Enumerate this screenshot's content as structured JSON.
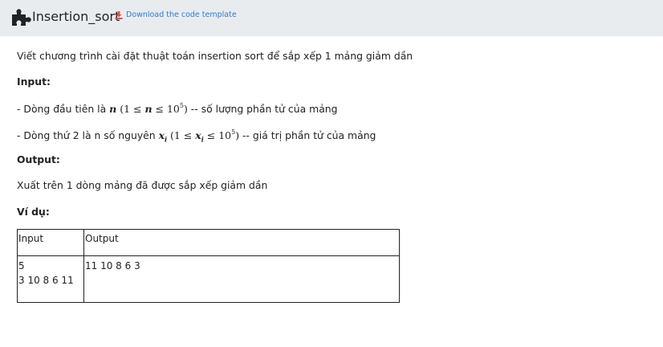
{
  "header": {
    "title": "Insertion_sort",
    "download_label": "Download the code template",
    "puzzle_icon": "puzzle-icon",
    "download_icon": "download-icon",
    "download_color": "#2f7bd4",
    "download_icon_color": "#d9534f",
    "background": "#e9ecef"
  },
  "problem": {
    "description": "Viết chương trình cài đặt thuật toán insertion sort để sắp xếp 1 mảng giảm dần",
    "input_heading": "Input:",
    "input_line1_prefix": "- Dòng đầu tiên là ",
    "input_line1_var": "n",
    "input_line1_cond_open": "(1 ≤ ",
    "input_line1_cond_var": "n",
    "input_line1_cond_close": " ≤ 10",
    "input_line1_exp": "5",
    "input_line1_paren": ")",
    "input_line1_suffix": " -- số lượng phần tử của mảng",
    "input_line2_prefix": "- Dòng thứ 2 là n số nguyên ",
    "input_line2_var": "x",
    "input_line2_sub": "i",
    "input_line2_cond_open": "(1 ≤ ",
    "input_line2_cond_var": "x",
    "input_line2_cond_sub": "i",
    "input_line2_cond_close": " ≤ 10",
    "input_line2_exp": "5",
    "input_line2_paren": ")",
    "input_line2_suffix": " -- giá trị phần tử của mảng",
    "output_heading": "Output:",
    "output_text": "Xuất trên 1 dòng mảng đã được sắp xếp giảm dần",
    "example_heading": "Ví dụ:"
  },
  "example_table": {
    "headers": [
      "Input",
      "Output"
    ],
    "input_lines": [
      "5",
      "3 10 8 6 11"
    ],
    "output_lines": [
      "11 10 8 6 3"
    ]
  }
}
